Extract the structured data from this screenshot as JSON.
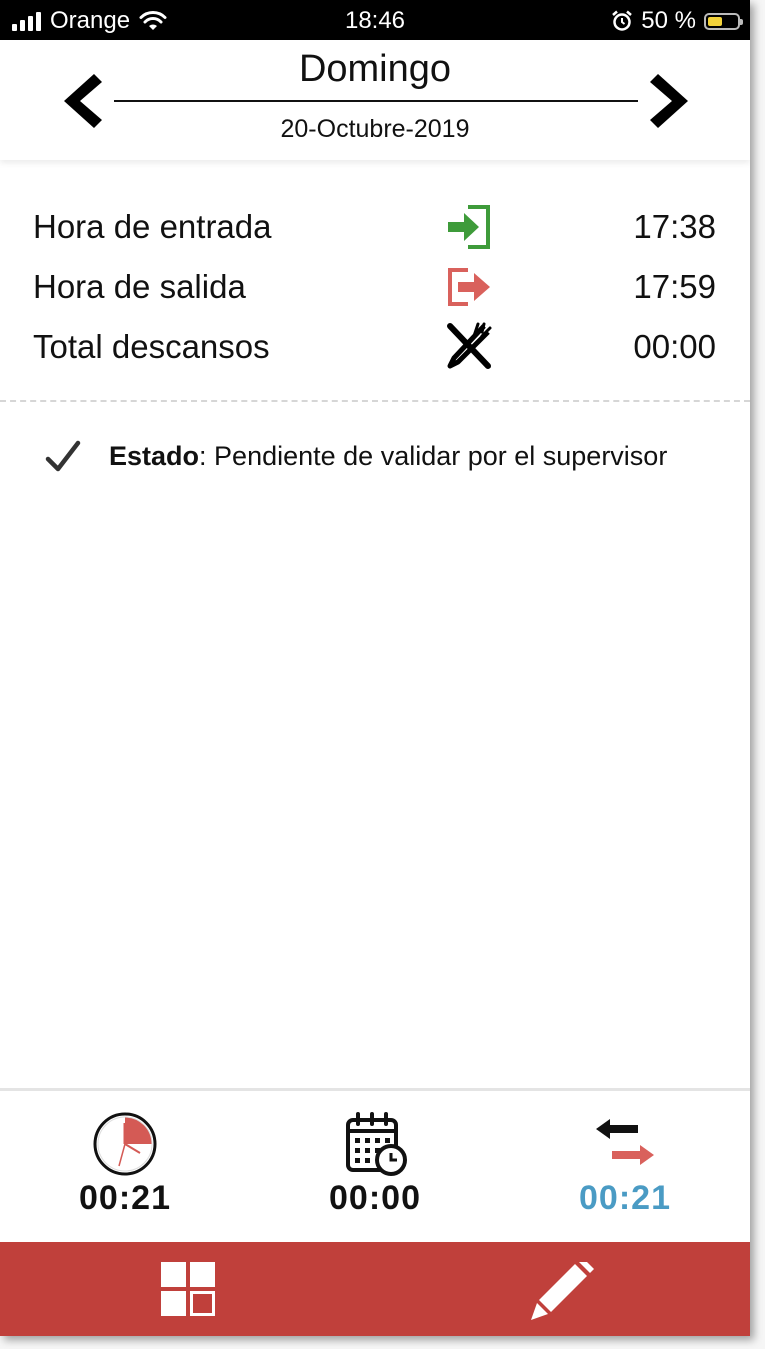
{
  "status_bar": {
    "carrier": "Orange",
    "time": "18:46",
    "battery": "50 %"
  },
  "header": {
    "day": "Domingo",
    "date": "20-Octubre-2019"
  },
  "rows": [
    {
      "label": "Hora de entrada",
      "icon": "entry-icon",
      "value": "17:38"
    },
    {
      "label": "Hora de salida",
      "icon": "exit-icon",
      "value": "17:59"
    },
    {
      "label": "Total descansos",
      "icon": "cutlery-icon",
      "value": "00:00"
    }
  ],
  "estado": {
    "label": "Estado",
    "separator": ": ",
    "text": "Pendiente de validar por el supervisor"
  },
  "summary": [
    {
      "icon": "clock-icon",
      "value": "00:21"
    },
    {
      "icon": "calendar-clock-icon",
      "value": "00:00"
    },
    {
      "icon": "swap-arrows-icon",
      "value": "00:21"
    }
  ],
  "colors": {
    "accent_red": "#c0403b",
    "entry_green": "#3e9b3a",
    "exit_red": "#d9615c",
    "summary_blue": "#4a9bc4"
  },
  "battery_level": 0.5
}
